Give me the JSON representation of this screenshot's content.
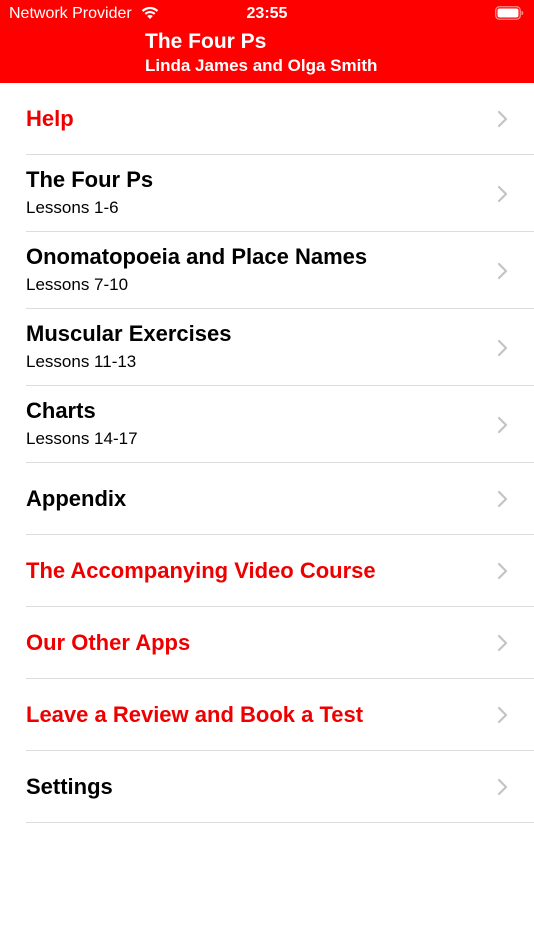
{
  "status_bar": {
    "carrier": "Network Provider",
    "time": "23:55",
    "icons": [
      "wifi-icon",
      "battery-icon"
    ]
  },
  "header": {
    "title": "The Four Ps",
    "subtitle": "Linda James and Olga Smith",
    "background_color": "#fe0000"
  },
  "accent_color": "#ee0000",
  "menu": {
    "chevron_icon": "chevron-right-icon",
    "items": [
      {
        "id": "help",
        "title": "Help",
        "subtitle": "",
        "highlight": true
      },
      {
        "id": "the-four-ps",
        "title": "The Four Ps",
        "subtitle": "Lessons 1-6",
        "highlight": false
      },
      {
        "id": "onomatopoeia",
        "title": "Onomatopoeia and Place Names",
        "subtitle": "Lessons 7-10",
        "highlight": false
      },
      {
        "id": "muscular-exercises",
        "title": "Muscular Exercises",
        "subtitle": "Lessons 11-13",
        "highlight": false
      },
      {
        "id": "charts",
        "title": "Charts",
        "subtitle": "Lessons 14-17",
        "highlight": false
      },
      {
        "id": "appendix",
        "title": "Appendix",
        "subtitle": "",
        "highlight": false
      },
      {
        "id": "video-course",
        "title": "The Accompanying Video Course",
        "subtitle": "",
        "highlight": true
      },
      {
        "id": "other-apps",
        "title": "Our Other Apps",
        "subtitle": "",
        "highlight": true
      },
      {
        "id": "review-test",
        "title": "Leave a Review and Book a Test",
        "subtitle": "",
        "highlight": true
      },
      {
        "id": "settings",
        "title": "Settings",
        "subtitle": "",
        "highlight": false
      }
    ]
  }
}
